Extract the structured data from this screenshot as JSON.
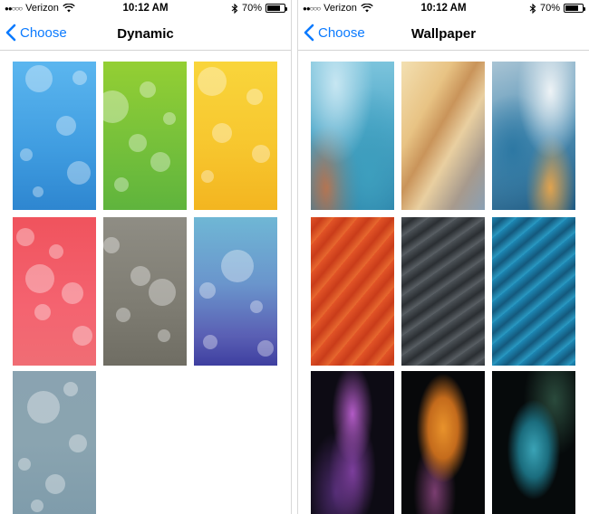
{
  "left_screen": {
    "status": {
      "carrier": "Verizon",
      "time": "10:12 AM",
      "battery": "70%",
      "battery_level": 0.7
    },
    "nav": {
      "back_label": "Choose",
      "title": "Dynamic"
    },
    "tiles": [
      {
        "name": "dynamic-blue"
      },
      {
        "name": "dynamic-green"
      },
      {
        "name": "dynamic-yellow"
      },
      {
        "name": "dynamic-red"
      },
      {
        "name": "dynamic-gray"
      },
      {
        "name": "dynamic-blue-purple"
      },
      {
        "name": "dynamic-slate"
      }
    ]
  },
  "right_screen": {
    "status": {
      "carrier": "Verizon",
      "time": "10:12 AM",
      "battery": "70%",
      "battery_level": 0.7
    },
    "nav": {
      "back_label": "Choose",
      "title": "Wallpaper"
    },
    "tiles": [
      {
        "name": "wallpaper-blue-abstract"
      },
      {
        "name": "wallpaper-gold-abstract"
      },
      {
        "name": "wallpaper-blue-gold-abstract"
      },
      {
        "name": "wallpaper-orange-feathers"
      },
      {
        "name": "wallpaper-gray-feathers"
      },
      {
        "name": "wallpaper-teal-feathers"
      },
      {
        "name": "wallpaper-purple-flower"
      },
      {
        "name": "wallpaper-orange-flower"
      },
      {
        "name": "wallpaper-teal-flower"
      }
    ]
  },
  "colors": {
    "accent": "#0a7aff"
  }
}
